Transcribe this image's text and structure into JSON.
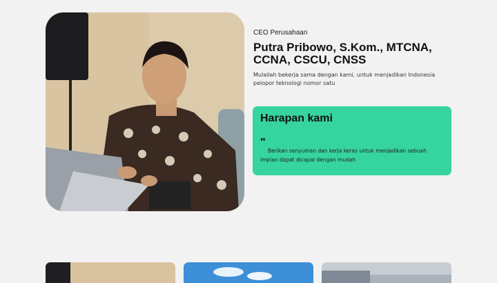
{
  "profile": {
    "role": "CEO Perusahaan",
    "name": "Putra Pribowo, S.Kom., MTCNA, CCNA, CSCU, CNSS",
    "tagline": "Mulailah bekerja sama dengan kami, untuk menjadikan Indonesia pelopor teknologi nomor satu"
  },
  "hope": {
    "title": "Harapan kami",
    "quote_mark": "\"",
    "text": "Berikan senyuman dan kerja keras untuk menjadikan sebuah impian dapat dicapai dengan mudah"
  },
  "colors": {
    "page_background": "#f2f2f2",
    "accent_card": "#36d49f"
  }
}
